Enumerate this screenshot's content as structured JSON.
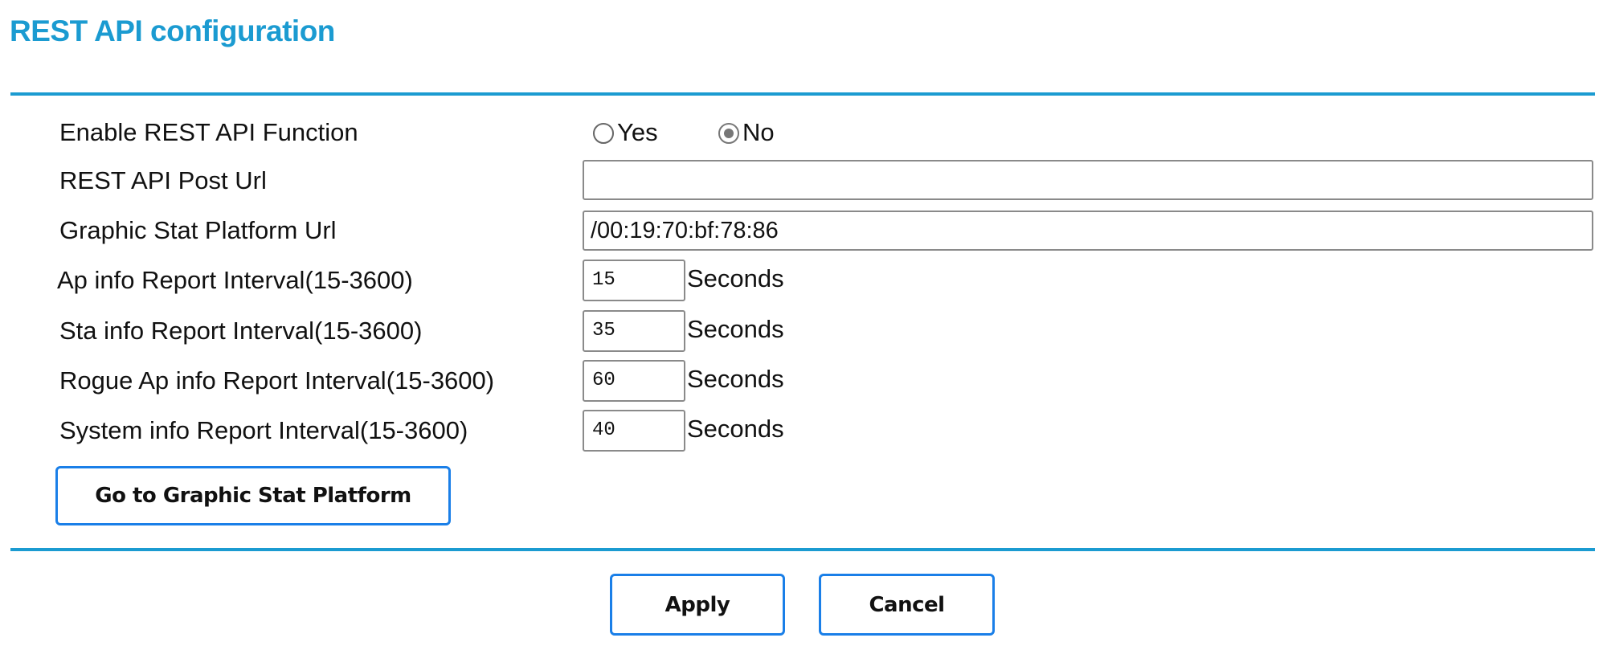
{
  "title": "REST API configuration",
  "colors": {
    "accent": "#1b9bd1",
    "button_border": "#1a7fe8"
  },
  "form": {
    "enable": {
      "label": "Enable REST API Function",
      "options": [
        {
          "label": "Yes",
          "checked": false
        },
        {
          "label": "No",
          "checked": true
        }
      ]
    },
    "post_url": {
      "label": "REST API Post Url",
      "value": ""
    },
    "platform_url": {
      "label": "Graphic Stat Platform Url",
      "value": "/00:19:70:bf:78:86"
    },
    "intervals": [
      {
        "label": "Ap info Report Interval(15-3600)",
        "value": "15",
        "unit": "Seconds"
      },
      {
        "label": "Sta info Report Interval(15-3600)",
        "value": "35",
        "unit": "Seconds"
      },
      {
        "label": "Rogue Ap info Report Interval(15-3600)",
        "value": "60",
        "unit": "Seconds"
      },
      {
        "label": "System info Report Interval(15-3600)",
        "value": "40",
        "unit": "Seconds"
      }
    ],
    "go_button": "Go to Graphic Stat Platform"
  },
  "footer": {
    "apply": "Apply",
    "cancel": "Cancel"
  }
}
